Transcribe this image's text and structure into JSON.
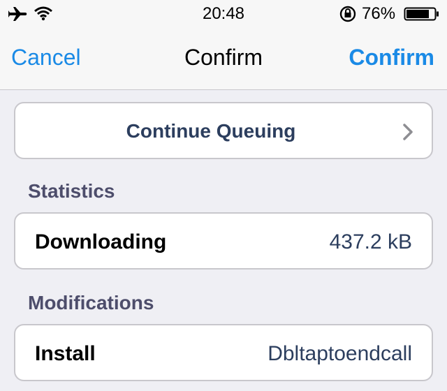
{
  "status_bar": {
    "time": "20:48",
    "battery_percent": "76%",
    "battery_level": 0.76,
    "icons": [
      "airplane-icon",
      "wifi-icon",
      "rotation-lock-icon",
      "battery-icon"
    ]
  },
  "nav": {
    "cancel_label": "Cancel",
    "title": "Confirm",
    "confirm_label": "Confirm"
  },
  "queue": {
    "label": "Continue Queuing"
  },
  "statistics": {
    "header": "Statistics",
    "downloading_label": "Downloading",
    "downloading_value": "437.2 kB"
  },
  "modifications": {
    "header": "Modifications",
    "install_label": "Install",
    "install_value": "Dbltaptoendcall"
  },
  "colors": {
    "accent": "#1a8ae6",
    "card_text": "#2c3e5e",
    "section_header": "#4d4d6b",
    "background": "#efeff4"
  }
}
